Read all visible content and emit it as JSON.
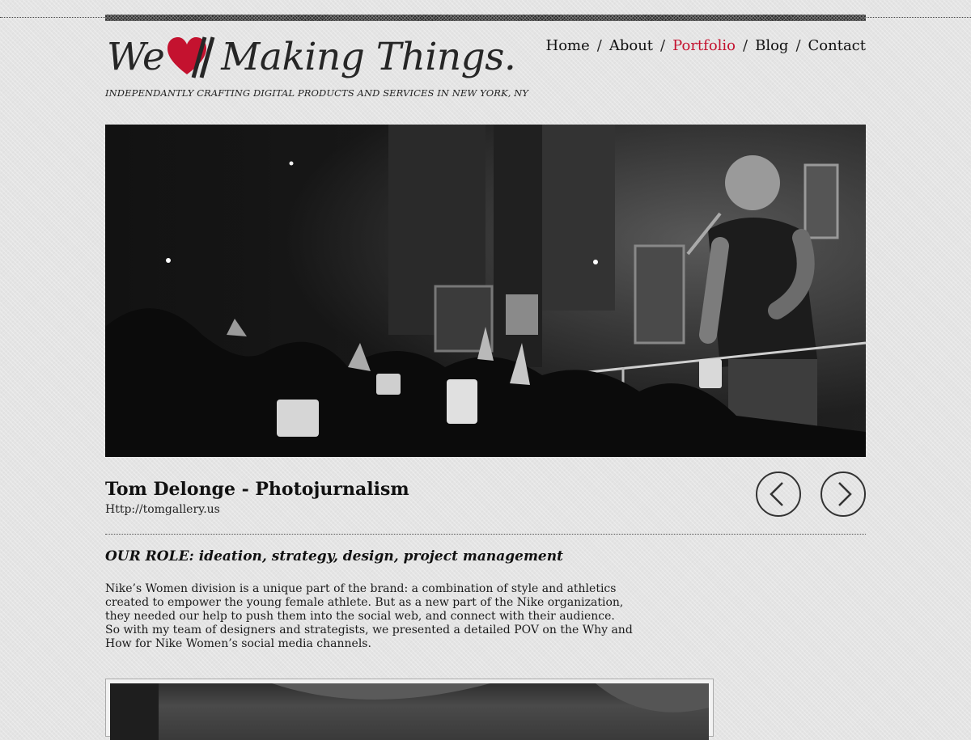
{
  "brand": {
    "logo_prefix": "We",
    "logo_suffix": "Making Things.",
    "tagline": "Independantly crafting digital products and services in New York, NY",
    "accent_color": "#c4122f",
    "logo_icon": "heart-slash-icon"
  },
  "nav": {
    "items": [
      {
        "label": "Home",
        "active": false
      },
      {
        "label": "About",
        "active": false
      },
      {
        "label": "Portfolio",
        "active": true
      },
      {
        "label": "Blog",
        "active": false
      },
      {
        "label": "Contact",
        "active": false
      }
    ],
    "separator": "/"
  },
  "project": {
    "title": "Tom Delonge - Photojurnalism",
    "url": "Http://tomgallery.us",
    "role": "OUR ROLE: ideation, strategy, design, project management",
    "description_lines": [
      "Nike’s Women division is a unique part of the brand: a combination of style and athletics",
      "created to empower the young female athlete. But as a new part of the Nike organization,",
      "they needed our help to push them into the social web, and connect with their audience.",
      "So with my team of designers and strategists, we presented a detailed POV on the Why and",
      "How for Nike Women’s social media channels."
    ]
  },
  "controls": {
    "prev_icon": "chevron-left-icon",
    "next_icon": "chevron-right-icon"
  }
}
